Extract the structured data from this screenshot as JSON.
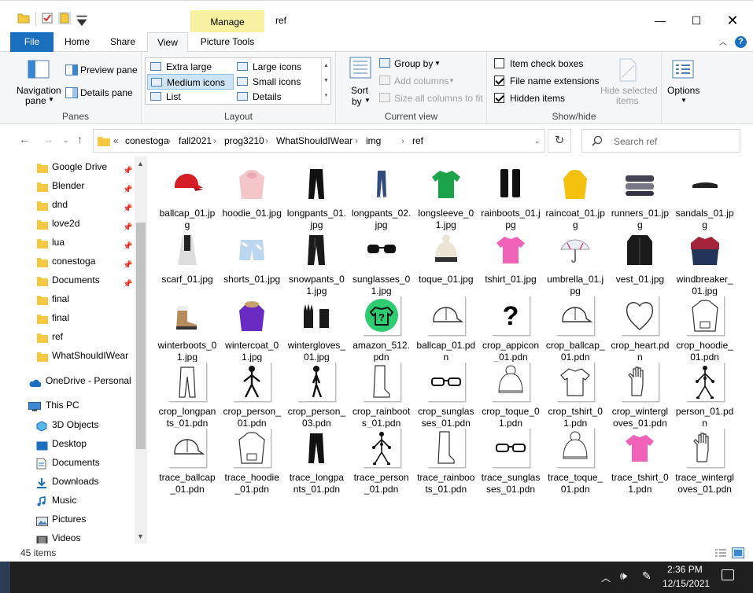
{
  "window": {
    "title": "ref",
    "manage_tab": "Manage",
    "controls": {
      "minimize": "—",
      "maximize": "☐",
      "close": "✕"
    }
  },
  "ribbon_tabs": {
    "file": "File",
    "home": "Home",
    "share": "Share",
    "view": "View",
    "picture_tools": "Picture Tools"
  },
  "ribbon": {
    "panes": {
      "title": "Panes",
      "navigation_pane": "Navigation",
      "navigation_pane_line2": "pane",
      "preview_pane": "Preview pane",
      "details_pane": "Details pane"
    },
    "layout": {
      "title": "Layout",
      "options": [
        "Extra large icons",
        "Large icons",
        "Medium icons",
        "Small icons",
        "List",
        "Details"
      ],
      "selected": "Medium icons"
    },
    "current_view": {
      "title": "Current view",
      "sort_by": "Sort",
      "sort_by_line2": "by",
      "group_by": "Group by",
      "add_columns": "Add columns",
      "size_all": "Size all columns to fit"
    },
    "show_hide": {
      "title": "Show/hide",
      "item_check_boxes": "Item check boxes",
      "file_name_extensions": "File name extensions",
      "hidden_items": "Hidden items",
      "hide_selected": "Hide selected",
      "hide_selected_line2": "items",
      "checks": {
        "item_check_boxes": false,
        "file_name_extensions": true,
        "hidden_items": true
      }
    },
    "options": {
      "label": "Options"
    }
  },
  "address": {
    "prefix": "«",
    "crumbs": [
      "conestoga",
      "fall2021",
      "prog3210",
      "WhatShouldIWear",
      "img",
      "ref"
    ],
    "separator": "›",
    "search_placeholder": "Search ref"
  },
  "nav": {
    "quick_access": [
      {
        "label": "Google Drive",
        "pinned": true
      },
      {
        "label": "Blender",
        "pinned": true
      },
      {
        "label": "dnd",
        "pinned": true
      },
      {
        "label": "love2d",
        "pinned": true
      },
      {
        "label": "lua",
        "pinned": true
      },
      {
        "label": "conestoga",
        "pinned": true
      },
      {
        "label": "Documents",
        "pinned": true
      },
      {
        "label": "final",
        "pinned": false
      },
      {
        "label": "final",
        "pinned": false
      },
      {
        "label": "ref",
        "pinned": false
      },
      {
        "label": "WhatShouldIWear",
        "pinned": false
      }
    ],
    "onedrive": "OneDrive - Personal",
    "this_pc": "This PC",
    "pc_items": [
      "3D Objects",
      "Desktop",
      "Documents",
      "Downloads",
      "Music",
      "Pictures",
      "Videos"
    ]
  },
  "files": [
    {
      "name": "ballcap_01.jpg",
      "icon": "red-cap"
    },
    {
      "name": "hoodie_01.jpg",
      "icon": "pink-hoodie"
    },
    {
      "name": "longpants_01.jpg",
      "icon": "black-pants"
    },
    {
      "name": "longpants_02.jpg",
      "icon": "jeans"
    },
    {
      "name": "longsleeve_01.jpg",
      "icon": "green-shirt"
    },
    {
      "name": "rainboots_01.jpg",
      "icon": "black-boots"
    },
    {
      "name": "raincoat_01.jpg",
      "icon": "yellow-coat"
    },
    {
      "name": "runners_01.jpg",
      "icon": "runners"
    },
    {
      "name": "sandals_01.jpg",
      "icon": "sandals"
    },
    {
      "name": "scarf_01.jpg",
      "icon": "scarf"
    },
    {
      "name": "shorts_01.jpg",
      "icon": "shorts"
    },
    {
      "name": "snowpants_01.jpg",
      "icon": "snowpants"
    },
    {
      "name": "sunglasses_01.jpg",
      "icon": "sunglasses"
    },
    {
      "name": "toque_01.jpg",
      "icon": "toque"
    },
    {
      "name": "tshirt_01.jpg",
      "icon": "pink-tshirt"
    },
    {
      "name": "umbrella_01.jpg",
      "icon": "umbrella"
    },
    {
      "name": "vest_01.jpg",
      "icon": "vest"
    },
    {
      "name": "windbreaker_01.jpg",
      "icon": "windbreaker"
    },
    {
      "name": "winterboots_01.jpg",
      "icon": "winterboots"
    },
    {
      "name": "wintercoat_01.jpg",
      "icon": "purple-coat"
    },
    {
      "name": "wintergloves_01.jpg",
      "icon": "gloves"
    },
    {
      "name": "amazon_512.pdn",
      "icon": "green-circle"
    },
    {
      "name": "ballcap_01.pdn",
      "icon": "outline-cap"
    },
    {
      "name": "crop_appicon_01.pdn",
      "icon": "question"
    },
    {
      "name": "crop_ballcap_01.pdn",
      "icon": "outline-cap"
    },
    {
      "name": "crop_heart.pdn",
      "icon": "heart"
    },
    {
      "name": "crop_hoodie_01.pdn",
      "icon": "outline-hoodie"
    },
    {
      "name": "crop_longpants_01.pdn",
      "icon": "outline-pants"
    },
    {
      "name": "crop_person_01.pdn",
      "icon": "stick-person"
    },
    {
      "name": "crop_person_03.pdn",
      "icon": "stick-walk"
    },
    {
      "name": "crop_rainboots_01.pdn",
      "icon": "outline-boot"
    },
    {
      "name": "crop_sunglasses_01.pdn",
      "icon": "outline-glasses"
    },
    {
      "name": "crop_toque_01.pdn",
      "icon": "outline-toque"
    },
    {
      "name": "crop_tshirt_01.pdn",
      "icon": "outline-tshirt"
    },
    {
      "name": "crop_wintergloves_01.pdn",
      "icon": "outline-glove"
    },
    {
      "name": "person_01.pdn",
      "icon": "dot-person"
    },
    {
      "name": "trace_ballcap_01.pdn",
      "icon": "outline-cap"
    },
    {
      "name": "trace_hoodie_01.pdn",
      "icon": "outline-hoodie"
    },
    {
      "name": "trace_longpants_01.pdn",
      "icon": "black-pants"
    },
    {
      "name": "trace_person_01.pdn",
      "icon": "dot-person"
    },
    {
      "name": "trace_rainboots_01.pdn",
      "icon": "outline-boot"
    },
    {
      "name": "trace_sunglasses_01.pdn",
      "icon": "outline-glasses"
    },
    {
      "name": "trace_toque_01.pdn",
      "icon": "outline-toque"
    },
    {
      "name": "trace_tshirt_01.pdn",
      "icon": "pink-tshirt"
    },
    {
      "name": "trace_wintergloves_01.pdn",
      "icon": "outline-glove"
    }
  ],
  "status": {
    "count": "45 items"
  },
  "taskbar": {
    "time": "2:36 PM",
    "date": "12/15/2021"
  },
  "colors": {
    "accent": "#1a6fbf",
    "folder": "#f5c842",
    "manage": "#f7f1a1",
    "selection": "#cde4f7"
  }
}
